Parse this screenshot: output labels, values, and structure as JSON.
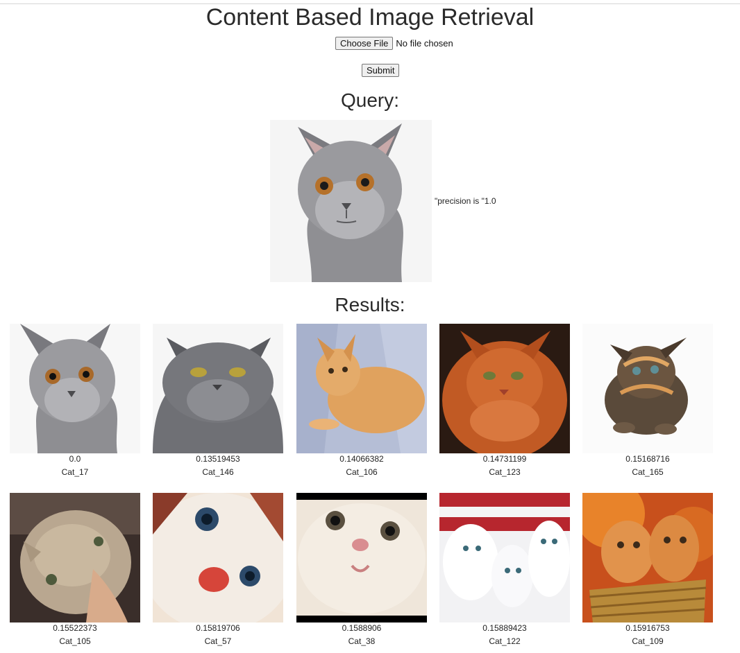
{
  "page": {
    "title": "Content Based Image Retrieval",
    "file_button_label": "Choose File",
    "file_status": "No file chosen",
    "submit_label": "Submit",
    "query_heading": "Query:",
    "results_heading": "Results:",
    "precision_text": "\"precision is \"1.0"
  },
  "results": [
    {
      "score": "0.0",
      "name": "Cat_17"
    },
    {
      "score": "0.13519453",
      "name": "Cat_146"
    },
    {
      "score": "0.14066382",
      "name": "Cat_106"
    },
    {
      "score": "0.14731199",
      "name": "Cat_123"
    },
    {
      "score": "0.15168716",
      "name": "Cat_165"
    },
    {
      "score": "0.15522373",
      "name": "Cat_105"
    },
    {
      "score": "0.15819706",
      "name": "Cat_57"
    },
    {
      "score": "0.1588906",
      "name": "Cat_38"
    },
    {
      "score": "0.15889423",
      "name": "Cat_122"
    },
    {
      "score": "0.15916753",
      "name": "Cat_109"
    }
  ]
}
